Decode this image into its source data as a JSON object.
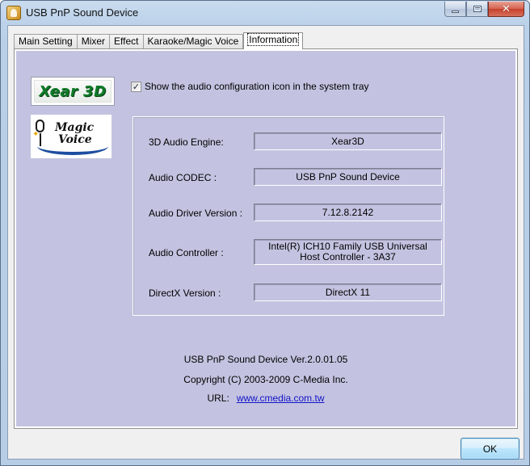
{
  "window": {
    "title": "USB PnP Sound Device"
  },
  "tabs": [
    {
      "label": "Main Setting"
    },
    {
      "label": "Mixer"
    },
    {
      "label": "Effect"
    },
    {
      "label": "Karaoke/Magic Voice"
    },
    {
      "label": "Information",
      "active": true
    }
  ],
  "logos": {
    "xear": "Xear 3D",
    "magic_voice_line1": "Magic",
    "magic_voice_line2": "Voice"
  },
  "tray_option": {
    "label": "Show the audio configuration icon in the system tray",
    "checked": true
  },
  "info": [
    {
      "label": "3D Audio Engine:",
      "value": "Xear3D"
    },
    {
      "label": "Audio CODEC :",
      "value": "USB PnP Sound Device"
    },
    {
      "label": "Audio Driver Version :",
      "value": "7.12.8.2142"
    },
    {
      "label": "Audio Controller :",
      "value": "Intel(R) ICH10 Family USB Universal Host Controller - 3A37"
    },
    {
      "label": "DirectX Version :",
      "value": "DirectX 11"
    }
  ],
  "about": {
    "version": "USB PnP Sound Device Ver.2.0.01.05",
    "copyright": "Copyright (C) 2003-2009 C-Media Inc.",
    "url_label": "URL:",
    "url": "www.cmedia.com.tw"
  },
  "buttons": {
    "ok": "OK"
  },
  "colors": {
    "panel_background": "#c3c3e1",
    "link": "#1414c8",
    "xear_logo_green": "#0f7a28"
  }
}
